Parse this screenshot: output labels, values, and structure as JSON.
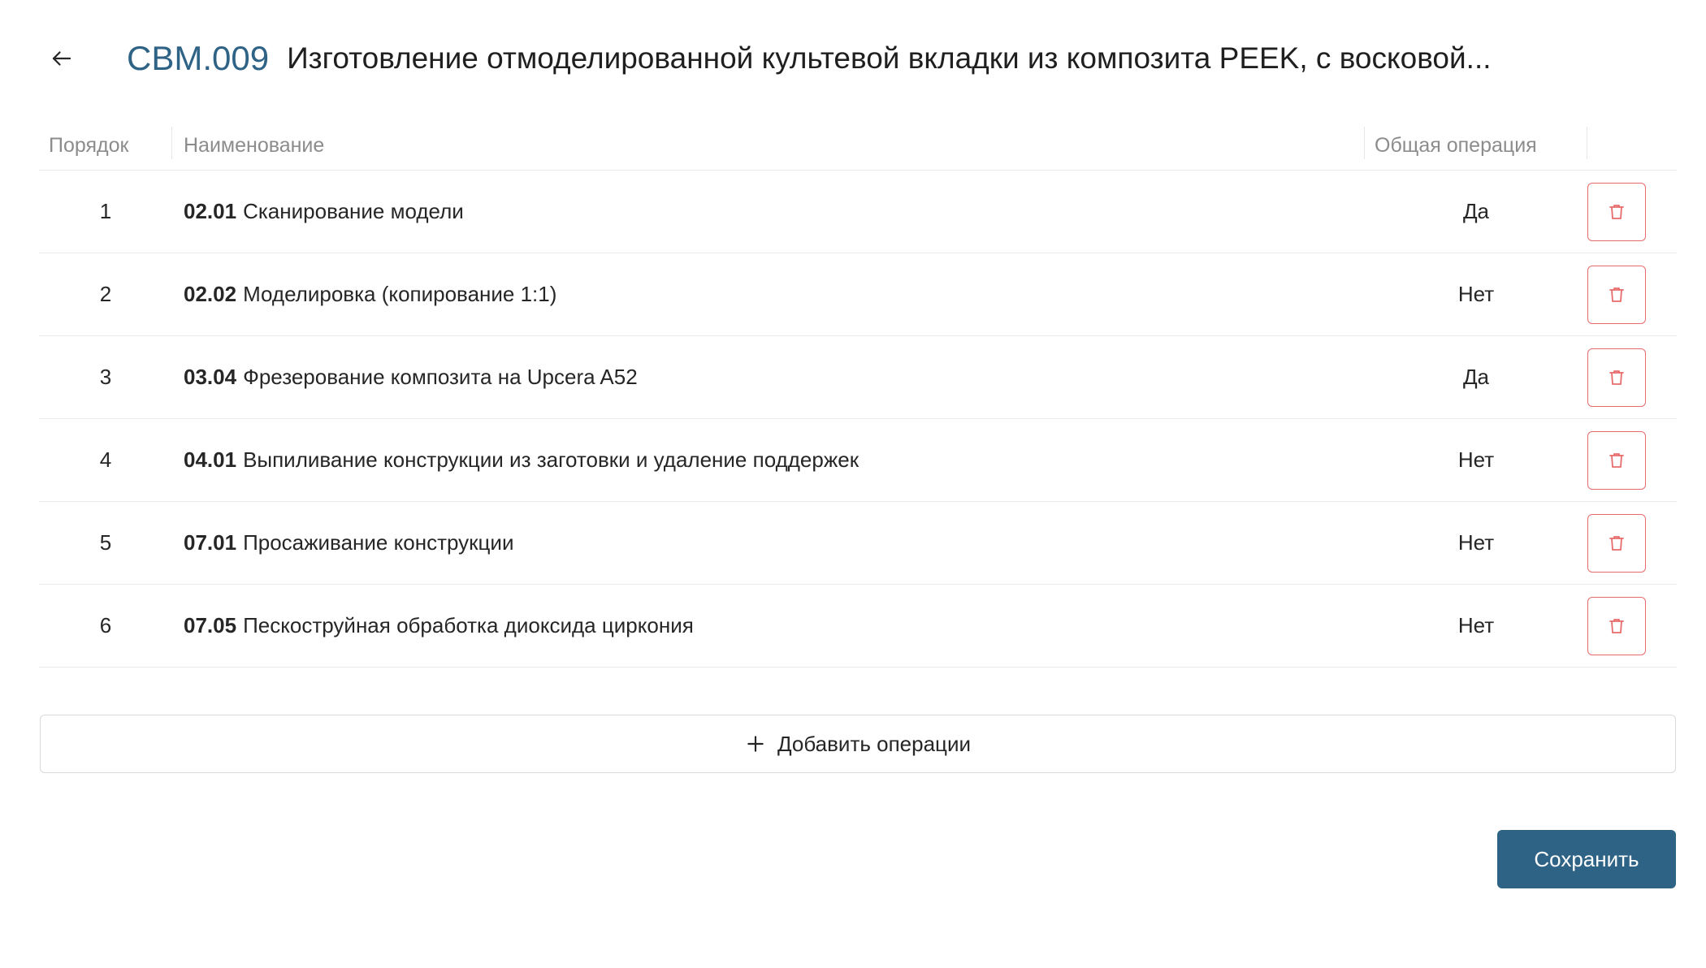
{
  "header": {
    "back_icon": "arrow-left-icon",
    "code": "СВМ.009",
    "title": "Изготовление отмоделированной культевой вкладки из композита PEEK, с восковой..."
  },
  "table": {
    "columns": {
      "order": "Порядок",
      "name": "Наименование",
      "common": "Общая операция"
    },
    "rows": [
      {
        "order": "1",
        "code": "02.01",
        "name": "Сканирование модели",
        "common": "Да"
      },
      {
        "order": "2",
        "code": "02.02",
        "name": "Моделировка (копирование 1:1)",
        "common": "Нет"
      },
      {
        "order": "3",
        "code": "03.04",
        "name": "Фрезерование композита на Upcera A52",
        "common": "Да"
      },
      {
        "order": "4",
        "code": "04.01",
        "name": "Выпиливание конструкции из заготовки и удаление поддержек",
        "common": "Нет"
      },
      {
        "order": "5",
        "code": "07.01",
        "name": "Просаживание конструкции",
        "common": "Нет"
      },
      {
        "order": "6",
        "code": "07.05",
        "name": "Пескоструйная обработка диоксида циркония",
        "common": "Нет"
      }
    ],
    "delete_icon": "trash-icon"
  },
  "actions": {
    "add_label": "Добавить операции",
    "add_icon": "plus-icon",
    "save_label": "Сохранить"
  },
  "colors": {
    "accent": "#2e6386",
    "danger": "#e86c6c"
  }
}
